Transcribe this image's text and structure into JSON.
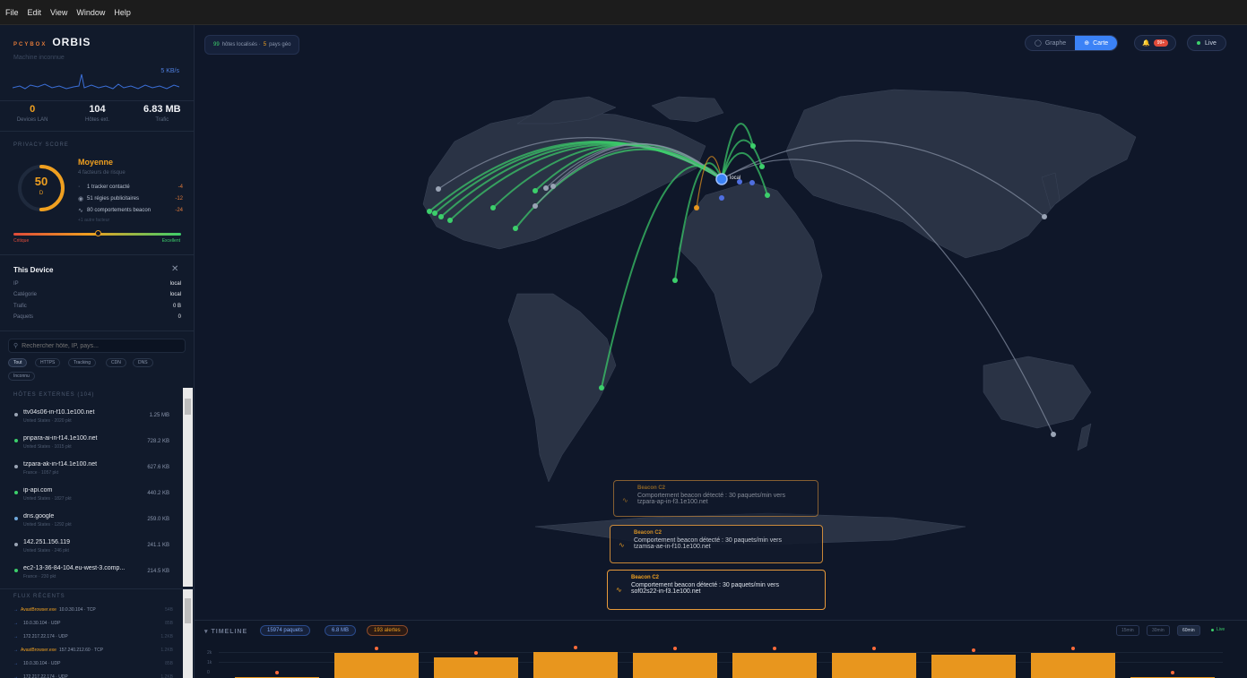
{
  "menu": [
    "File",
    "Edit",
    "View",
    "Window",
    "Help"
  ],
  "brand": {
    "small": "PCYBOX",
    "name": "ORBIS"
  },
  "machine_label": "Machine inconnue",
  "rate": "5 KB/s",
  "stats": [
    {
      "value": "0",
      "label": "Devices LAN",
      "color": "#f0a020"
    },
    {
      "value": "104",
      "label": "Hôtes ext.",
      "color": "#f1f3f7"
    },
    {
      "value": "6.83 MB",
      "label": "Trafic",
      "color": "#f1f3f7"
    }
  ],
  "privacy": {
    "title": "PRIVACY SCORE",
    "score": "50",
    "score_sub": "D",
    "score_fraction": 0.5,
    "level": "Moyenne",
    "factors_label": "4 facteurs de risque",
    "items": [
      {
        "icon": "radio-icon",
        "glyph": "((·))",
        "text": "1 tracker contacté",
        "delta": "-4"
      },
      {
        "icon": "ad-icon",
        "glyph": "◉",
        "text": "51 régies publicitaires",
        "delta": "-12"
      },
      {
        "icon": "pulse-icon",
        "glyph": "∿",
        "text": "80 comportements beacon",
        "delta": "-24"
      }
    ],
    "more": "+1 autre facteur",
    "scale_low": "Critique",
    "scale_high": "Excellent",
    "slider_fraction": 0.5
  },
  "device": {
    "title": "This Device",
    "rows": [
      {
        "label": "IP",
        "value": "local"
      },
      {
        "label": "Catégorie",
        "value": "local"
      },
      {
        "label": "Trafic",
        "value": "0 B"
      },
      {
        "label": "Paquets",
        "value": "0"
      }
    ]
  },
  "search": {
    "placeholder": "Rechercher hôte, IP, pays..."
  },
  "filters": [
    "Tout",
    "HTTPS",
    "Tracking",
    "CDN",
    "DNS",
    "Inconnu"
  ],
  "hosts_title": "HÔTES EXTERNES (104)",
  "hosts": [
    {
      "name": "ttv04s06-in-f10.1e100.net",
      "meta": "United States · 2020 pkt",
      "size": "1.25 MB",
      "color": "#9aa4b5"
    },
    {
      "name": "pnpara-ai-in-f14.1e100.net",
      "meta": "United States · 1015 pkt",
      "size": "728.2 KB",
      "color": "#3ccf6b"
    },
    {
      "name": "tzpara-ak-in-f14.1e100.net",
      "meta": "France · 1057 pkt",
      "size": "627.6 KB",
      "color": "#9aa4b5"
    },
    {
      "name": "ip-api.com",
      "meta": "United States · 1827 pkt",
      "size": "440.2 KB",
      "color": "#3ccf6b"
    },
    {
      "name": "dns.google",
      "meta": "United States · 1292 pkt",
      "size": "259.0 KB",
      "color": "#6fa8dc"
    },
    {
      "name": "142.251.156.119",
      "meta": "United States · 246 pkt",
      "size": "241.1 KB",
      "color": "#9aa4b5"
    },
    {
      "name": "ec2-13-36-84-104.eu-west-3.comp...",
      "meta": "France · 230 pkt",
      "size": "214.5 KB",
      "color": "#3ccf6b"
    }
  ],
  "flux_title": "FLUX RÉCENTS",
  "flux": [
    {
      "proc": "AvastBrowser.exe",
      "text": "10.0.30.104 · TCP",
      "n": "54B"
    },
    {
      "proc": "",
      "text": "10.0.30.104 · UDP",
      "n": "85B"
    },
    {
      "proc": "",
      "text": "172.217.22.174 · UDP",
      "n": "1.2KB"
    },
    {
      "proc": "AvastBrowser.exe",
      "text": "157.240.212.60 · TCP",
      "n": "1.2KB"
    },
    {
      "proc": "",
      "text": "10.0.30.104 · UDP",
      "n": "85B"
    },
    {
      "proc": "",
      "text": "172.217.22.174 · UDP",
      "n": "1.2KB"
    }
  ],
  "top_info": {
    "hosts_count": "99",
    "hosts_text": "hôtes localisés · ",
    "countries_count": "5",
    "countries_text": "pays géo"
  },
  "view_toggle": [
    {
      "label": "Graphe",
      "icon": "graph-icon",
      "glyph": "◯",
      "active": false
    },
    {
      "label": "Carte",
      "icon": "globe-icon",
      "glyph": "⊕",
      "active": true
    }
  ],
  "alerts_badge": "99+",
  "live_label": "Live",
  "local_label": "local",
  "alerts": [
    {
      "title": "Beacon C2",
      "line1": "Comportement beacon détecté : 30 paquets/min vers",
      "line2": "tzpara-ap-in-f3.1e100.net"
    },
    {
      "title": "Beacon C2",
      "line1": "Comportement beacon détecté : 30 paquets/min vers",
      "line2": "tzamsa-ae-in-f10.1e100.net"
    },
    {
      "title": "Beacon C2",
      "line1": "Comportement beacon détecté : 30 paquets/min vers",
      "line2": "sof02s22-in-f3.1e100.net"
    }
  ],
  "timeline": {
    "title": "TIMELINE",
    "packets": "15974 paquets",
    "bytes": "6.8 MB",
    "alerts": "193 alertes",
    "ranges": [
      "15min",
      "30min",
      "60min"
    ],
    "active_range": "60min",
    "live": "Live",
    "y_ticks": [
      "2k",
      "1k",
      "0"
    ],
    "bar_levels": [
      0.05,
      0.95,
      0.8,
      1.0,
      0.95,
      0.95,
      0.95,
      0.9,
      0.95,
      0.05
    ]
  }
}
